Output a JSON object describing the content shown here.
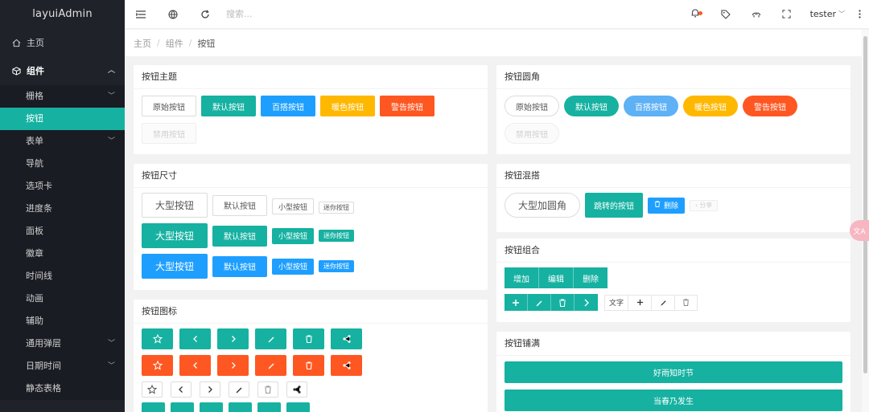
{
  "app": {
    "title": "layuiAdmin"
  },
  "sidebar": {
    "home": "主页",
    "components": "组件",
    "items": [
      "栅格",
      "按钮",
      "表单",
      "导航",
      "选项卡",
      "进度条",
      "面板",
      "徽章",
      "时间线",
      "动画",
      "辅助",
      "通用弹层",
      "日期时间",
      "静态表格"
    ]
  },
  "header": {
    "search_placeholder": "搜索...",
    "user": "tester"
  },
  "breadcrumb": [
    "主页",
    "组件",
    "按钮"
  ],
  "cards": {
    "theme": {
      "title": "按钮主题",
      "buttons": [
        "原始按钮",
        "默认按钮",
        "百搭按钮",
        "暖色按钮",
        "警告按钮",
        "禁用按钮"
      ]
    },
    "radius": {
      "title": "按钮圆角",
      "buttons": [
        "原始按钮",
        "默认按钮",
        "百搭按钮",
        "暖色按钮",
        "警告按钮",
        "禁用按钮"
      ]
    },
    "size": {
      "title": "按钮尺寸",
      "buttons": [
        "大型按钮",
        "默认按钮",
        "小型按钮",
        "迷你按钮"
      ]
    },
    "mix": {
      "title": "按钮混搭",
      "btn1": "大型加圆角",
      "btn2": "跳转的按钮",
      "btn3": "删除",
      "btn4": "分享"
    },
    "group": {
      "title": "按钮组合",
      "row1": [
        "增加",
        "编辑",
        "删除"
      ],
      "text": "文字"
    },
    "icons": {
      "title": "按钮图标"
    },
    "fluid": {
      "title": "按钮铺满",
      "buttons": [
        "好雨知时节",
        "当春乃发生"
      ]
    }
  },
  "colors": {
    "teal": "#16b1a1",
    "blue": "#1e9fff",
    "warm": "#ffb800",
    "danger": "#ff5722",
    "sidebar": "#20222a"
  }
}
